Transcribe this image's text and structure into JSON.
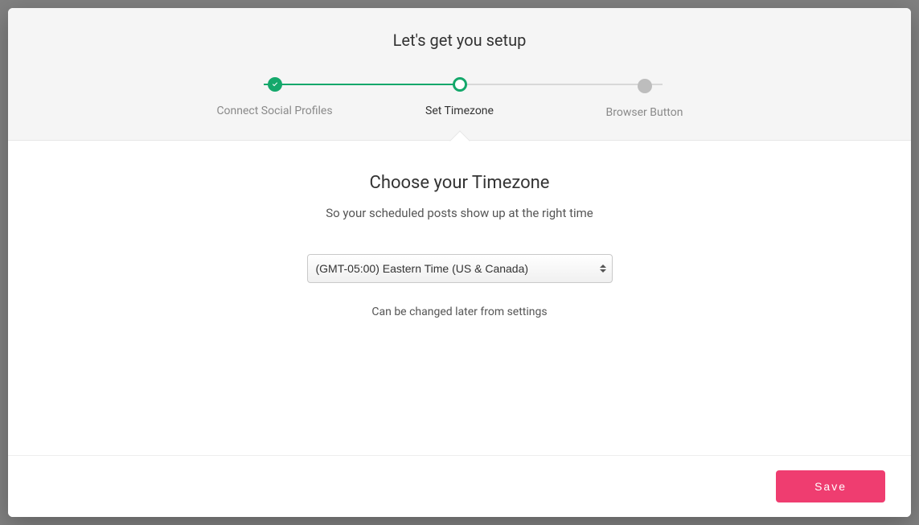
{
  "header": {
    "title": "Let's get you setup",
    "steps": [
      {
        "label": "Connect Social Profiles",
        "state": "complete"
      },
      {
        "label": "Set Timezone",
        "state": "current"
      },
      {
        "label": "Browser Button",
        "state": "upcoming"
      }
    ]
  },
  "main": {
    "heading": "Choose your Timezone",
    "subheading": "So your scheduled posts show up at the right time",
    "timezone_selected": "(GMT-05:00) Eastern Time (US & Canada)",
    "hint": "Can be changed later from settings"
  },
  "footer": {
    "save_label": "Save"
  },
  "colors": {
    "accent_green": "#14a86b",
    "accent_pink": "#ef3d70"
  }
}
